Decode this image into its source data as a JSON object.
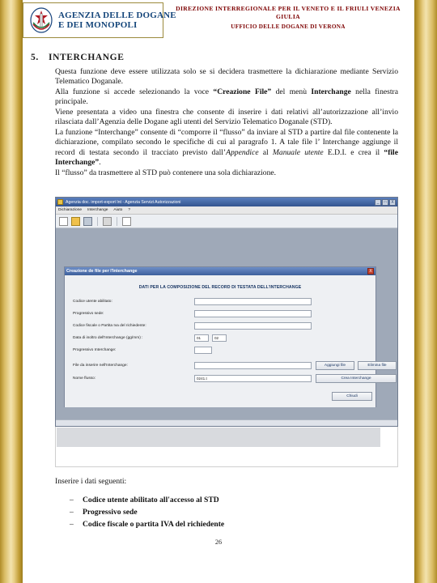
{
  "header": {
    "logo": {
      "line1": "AGENZIA DELLE DOGANE",
      "line2": "E DEI MONOPOLI",
      "emblem_name": "italian-republic-emblem"
    },
    "title_line1": "DIREZIONE INTERREGIONALE PER IL VENETO E IL FRIULI VENEZIA GIULIA",
    "title_line2": "UFFICIO DELLE DOGANE DI VERONA"
  },
  "section": {
    "number": "5.",
    "heading": "INTERCHANGE",
    "paragraph_html": "Questa funzione deve essere utilizzata solo se si decidera trasmettere la dichiarazione mediante Servizio Telematico Doganale.<br>Alla funzione si accede selezionando la voce <b>&ldquo;Creazione File&rdquo;</b> del  men&ugrave; <b>Interchange</b> nella finestra principale.<br>Viene presentata a video una finestra che consente di inserire i dati relativi all&rsquo;autorizzazione all&rsquo;invio rilasciata dall&rsquo;Agenzia delle Dogane agli utenti del Servizio Telematico Doganale (STD).<br>La funzione &ldquo;Interchange&rdquo; consente di &ldquo;comporre il &ldquo;flusso&rdquo; da inviare al STD a partire dal file contenente la dichiarazione, compilato secondo le specifiche di cui al paragrafo 1. A tale file l&rsquo; Interchange aggiunge  il  record  di  testata  secondo  il  tracciato  previsto  dall&rsquo;<i>Appendice</i>  al <i>Manuale utente</i> E.D.I. e crea il <b>&ldquo;file Interchange&rdquo;</b>.<br>Il &ldquo;flusso&rdquo; da trasmettere al  STD pu&ograve; contenere una sola dichiarazione."
  },
  "screenshot": {
    "window": {
      "title": "Agenzia doc. import-export lnt - Agenzia Servizi Autorizzazioni",
      "buttons": [
        "_",
        "□",
        "X"
      ],
      "menu": [
        "Dichiarazione",
        "Interchange",
        "Aiuto",
        "?"
      ],
      "toolbar_icons": [
        "new-document-icon",
        "open-folder-icon",
        "save-disk-icon",
        "print-icon",
        "help-icon"
      ]
    },
    "dialog": {
      "title": "Creazione de  file per l'Interchange",
      "close_label": "X",
      "heading": "DATI PER LA COMPOSIZIONE DEL RECORD DI TESTATA DELL'INTERCHANGE",
      "fields": [
        {
          "label": "Codice utente abilitato:",
          "value": ""
        },
        {
          "label": "Progressivo sede:",
          "value": ""
        },
        {
          "label": "Codice fiscale o Partita Iva del richiedente:",
          "value": ""
        },
        {
          "label": "Data  di  inoltro dell'Interchange (gg/mm) :",
          "value_day": "01",
          "value_month": "02"
        },
        {
          "label": "Progressivo Interchange:",
          "value": ""
        },
        {
          "label": "File da inserire nell'Interchange:",
          "value": ""
        },
        {
          "label": "Nome flusso:",
          "value": "0241.t"
        }
      ],
      "buttons": [
        {
          "label": "Aggiungi file"
        },
        {
          "label": "Elimina file"
        },
        {
          "label": "Crea Interchange"
        },
        {
          "label": "Chiudi"
        }
      ]
    }
  },
  "after": {
    "intro": "Inserire i dati seguenti:",
    "items": [
      "Codice utente abilitato all'accesso al STD",
      "Progressivo sede",
      "Codice fiscale o partita IVA del richiedente"
    ],
    "bullet_char": "–"
  },
  "page_number": "26"
}
